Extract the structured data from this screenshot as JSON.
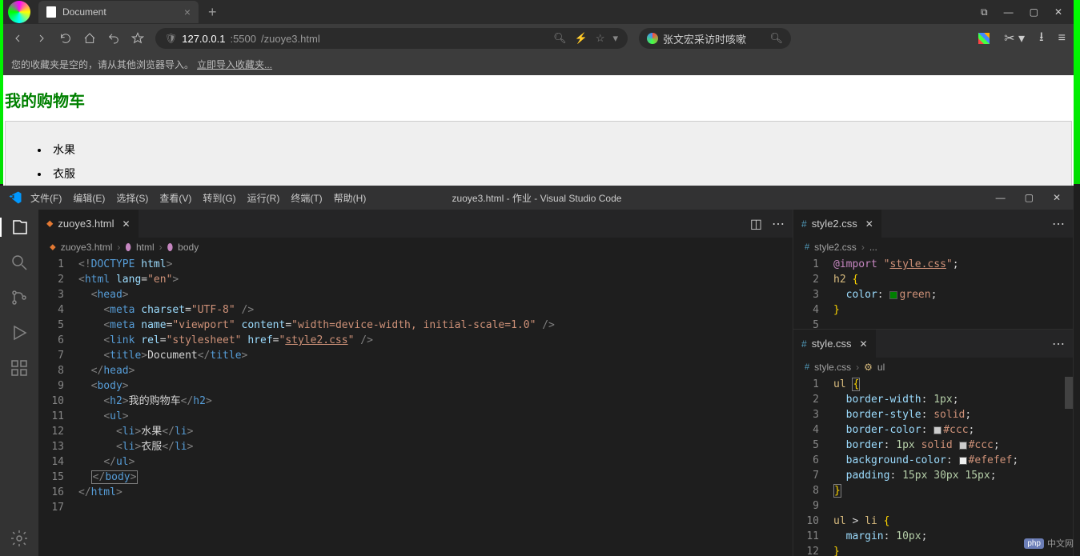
{
  "browser": {
    "tab_title": "Document",
    "url_host": "127.0.0.1",
    "url_port": ":5500",
    "url_path": "/zuoye3.html",
    "search_placeholder": "张文宏采访时咳嗽",
    "bookmark_empty": "您的收藏夹是空的，请从其他浏览器导入。",
    "bookmark_import": "立即导入收藏夹..."
  },
  "page": {
    "heading": "我的购物车",
    "items": [
      "水果",
      "衣服"
    ]
  },
  "vscode": {
    "menus": [
      "文件(F)",
      "编辑(E)",
      "选择(S)",
      "查看(V)",
      "转到(G)",
      "运行(R)",
      "终端(T)",
      "帮助(H)"
    ],
    "title": "zuoye3.html - 作业 - Visual Studio Code",
    "left_tab": "zuoye3.html",
    "left_breadcrumb": [
      "zuoye3.html",
      "html",
      "body"
    ],
    "right_tab1": "style2.css",
    "right_bc1": [
      "style2.css",
      "..."
    ],
    "right_tab2": "style.css",
    "right_bc2": [
      "style.css",
      "ul"
    ],
    "left_lines": {
      "1": "<!DOCTYPE html>",
      "2": "<html lang=\"en\">",
      "3": "<head>",
      "4": "<meta charset=\"UTF-8\" />",
      "5": "<meta name=\"viewport\" content=\"width=device-width, initial-scale=1.0\" />",
      "6": "<link rel=\"stylesheet\" href=\"style2.css\" />",
      "7": "<title>Document</title>",
      "8": "</head>",
      "9": "<body>",
      "10": "<h2>我的购物车</h2>",
      "11": "<ul>",
      "12": "<li>水果</li>",
      "13": "<li>衣服</li>",
      "14": "</ul>",
      "15": "</body>",
      "16": "</html>"
    },
    "style2_lines": {
      "1": "@import \"style.css\";",
      "2": "h2 {",
      "3": "color: green;",
      "4": "}"
    },
    "style_lines": {
      "1": "ul {",
      "2": "border-width: 1px;",
      "3": "border-style: solid;",
      "4": "border-color: #ccc;",
      "5": "border: 1px solid #ccc;",
      "6": "background-color: #efefef;",
      "7": "padding: 15px 30px 15px;",
      "8": "}",
      "10": "ul > li {",
      "11": "margin: 10px;",
      "12": "}"
    }
  },
  "watermark": "中文网"
}
